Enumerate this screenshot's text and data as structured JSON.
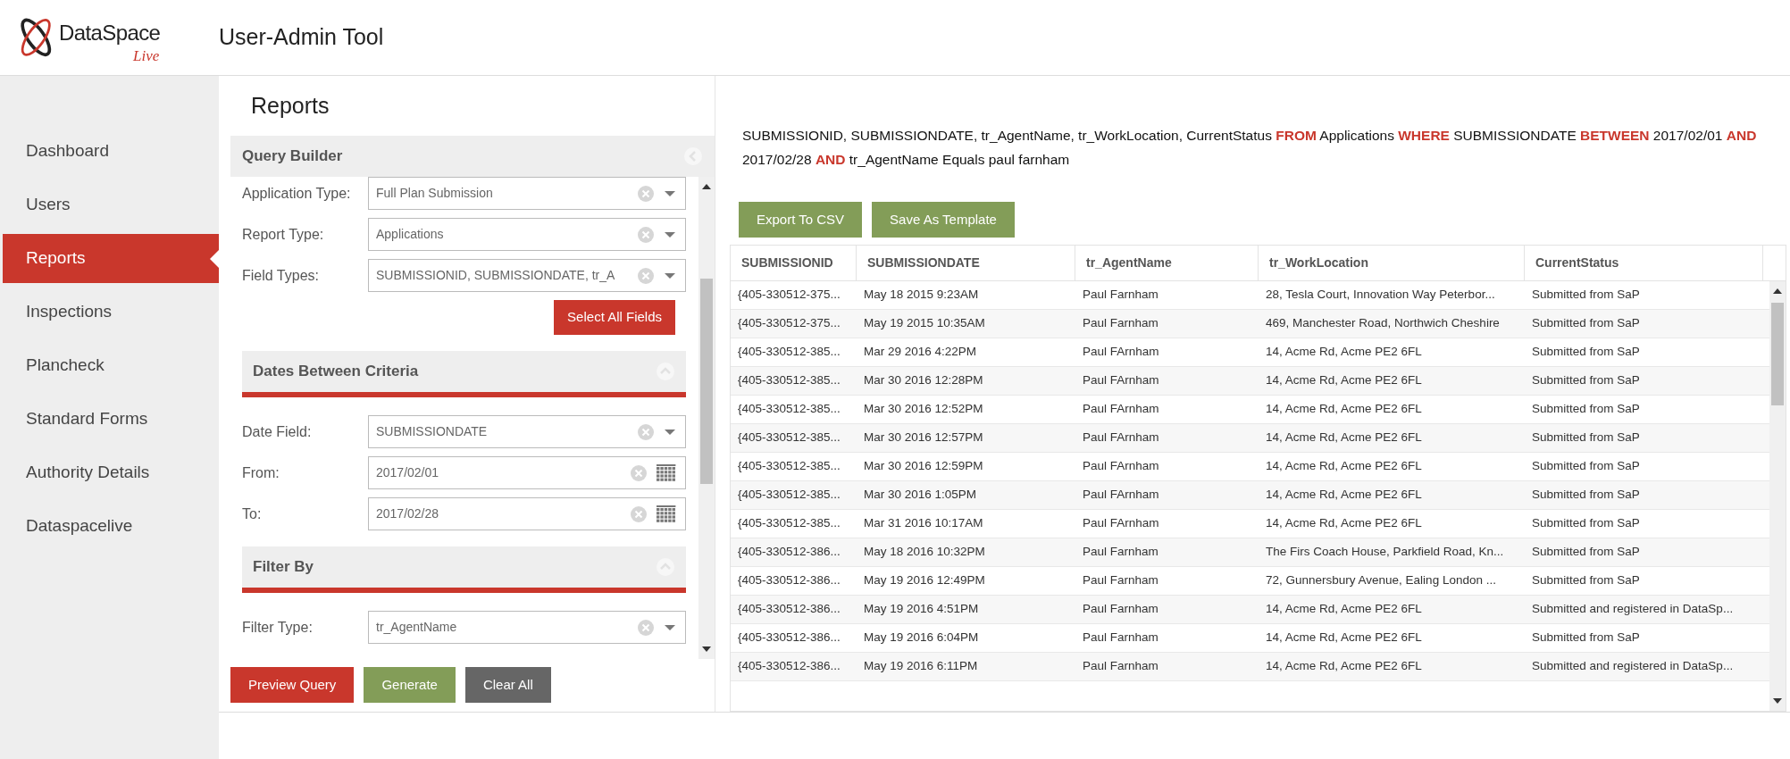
{
  "logo": {
    "name": "DataSpace",
    "tagline": "Live"
  },
  "app_title": "User-Admin Tool",
  "sidebar": {
    "items": [
      {
        "label": "Dashboard",
        "selected": false
      },
      {
        "label": "Users",
        "selected": false
      },
      {
        "label": "Reports",
        "selected": true
      },
      {
        "label": "Inspections",
        "selected": false
      },
      {
        "label": "Plancheck",
        "selected": false
      },
      {
        "label": "Standard Forms",
        "selected": false
      },
      {
        "label": "Authority Details",
        "selected": false
      },
      {
        "label": "Dataspacelive",
        "selected": false
      }
    ]
  },
  "page_title": "Reports",
  "query_builder": {
    "title": "Query Builder",
    "fields": [
      {
        "label": "Application Type:",
        "value": "Full Plan Submission",
        "kind": "select"
      },
      {
        "label": "Report Type:",
        "value": "Applications",
        "kind": "select"
      },
      {
        "label": "Field Types:",
        "value": "SUBMISSIONID, SUBMISSIONDATE, tr_A",
        "kind": "select"
      }
    ],
    "select_all_button": "Select All Fields",
    "sections": [
      {
        "title": "Dates Between Criteria",
        "fields": [
          {
            "label": "Date Field:",
            "value": "SUBMISSIONDATE",
            "kind": "select"
          },
          {
            "label": "From:",
            "value": "2017/02/01",
            "kind": "date"
          },
          {
            "label": "To:",
            "value": "2017/02/28",
            "kind": "date"
          }
        ]
      },
      {
        "title": "Filter By",
        "fields": [
          {
            "label": "Filter Type:",
            "value": "tr_AgentName",
            "kind": "select"
          }
        ]
      }
    ],
    "buttons": [
      {
        "label": "Preview Query",
        "kind": "red"
      },
      {
        "label": "Generate",
        "kind": "green"
      },
      {
        "label": "Clear All",
        "kind": "grey"
      }
    ]
  },
  "query_text": "SUBMISSIONID, SUBMISSIONDATE, tr_AgentName, tr_WorkLocation, CurrentStatus **FROM** Applications **WHERE** SUBMISSIONDATE **BETWEEN** 2017/02/01 **AND** 2017/02/28 **AND** tr_AgentName Equals paul farnham",
  "result_buttons": [
    "Export To CSV",
    "Save As Template"
  ],
  "table": {
    "columns": [
      "SUBMISSIONID",
      "SUBMISSIONDATE",
      "tr_AgentName",
      "tr_WorkLocation",
      "CurrentStatus"
    ],
    "rows": [
      [
        "{405-330512-375...",
        "May 18 2015 9:23AM",
        "Paul Farnham",
        "28, Tesla Court, Innovation Way Peterbor...",
        "Submitted from SaP"
      ],
      [
        "{405-330512-375...",
        "May 19 2015 10:35AM",
        "Paul Farnham",
        "469, Manchester Road, Northwich Cheshire",
        "Submitted from SaP"
      ],
      [
        "{405-330512-385...",
        "Mar 29 2016 4:22PM",
        "Paul FArnham",
        "14, Acme Rd, Acme PE2 6FL",
        "Submitted from SaP"
      ],
      [
        "{405-330512-385...",
        "Mar 30 2016 12:28PM",
        "Paul FArnham",
        "14, Acme Rd, Acme PE2 6FL",
        "Submitted from SaP"
      ],
      [
        "{405-330512-385...",
        "Mar 30 2016 12:52PM",
        "Paul FArnham",
        "14, Acme Rd, Acme PE2 6FL",
        "Submitted from SaP"
      ],
      [
        "{405-330512-385...",
        "Mar 30 2016 12:57PM",
        "Paul FArnham",
        "14, Acme Rd, Acme PE2 6FL",
        "Submitted from SaP"
      ],
      [
        "{405-330512-385...",
        "Mar 30 2016 12:59PM",
        "Paul FArnham",
        "14, Acme Rd, Acme PE2 6FL",
        "Submitted from SaP"
      ],
      [
        "{405-330512-385...",
        "Mar 30 2016 1:05PM",
        "Paul FArnham",
        "14, Acme Rd, Acme PE2 6FL",
        "Submitted from SaP"
      ],
      [
        "{405-330512-385...",
        "Mar 31 2016 10:17AM",
        "Paul FArnham",
        "14, Acme Rd, Acme PE2 6FL",
        "Submitted from SaP"
      ],
      [
        "{405-330512-386...",
        "May 18 2016 10:32PM",
        "Paul Farnham",
        "The Firs Coach House, Parkfield Road, Kn...",
        "Submitted from SaP"
      ],
      [
        "{405-330512-386...",
        "May 19 2016 12:49PM",
        "Paul Farnham",
        "72, Gunnersbury Avenue, Ealing London ...",
        "Submitted from SaP"
      ],
      [
        "{405-330512-386...",
        "May 19 2016 4:51PM",
        "Paul Farnham",
        "14, Acme Rd, Acme PE2 6FL",
        "Submitted and registered in DataSp..."
      ],
      [
        "{405-330512-386...",
        "May 19 2016 6:04PM",
        "Paul Farnham",
        "14, Acme Rd, Acme PE2 6FL",
        "Submitted from SaP"
      ],
      [
        "{405-330512-386...",
        "May 19 2016 6:11PM",
        "Paul Farnham",
        "14, Acme Rd, Acme PE2 6FL",
        "Submitted and registered in DataSp..."
      ]
    ]
  }
}
